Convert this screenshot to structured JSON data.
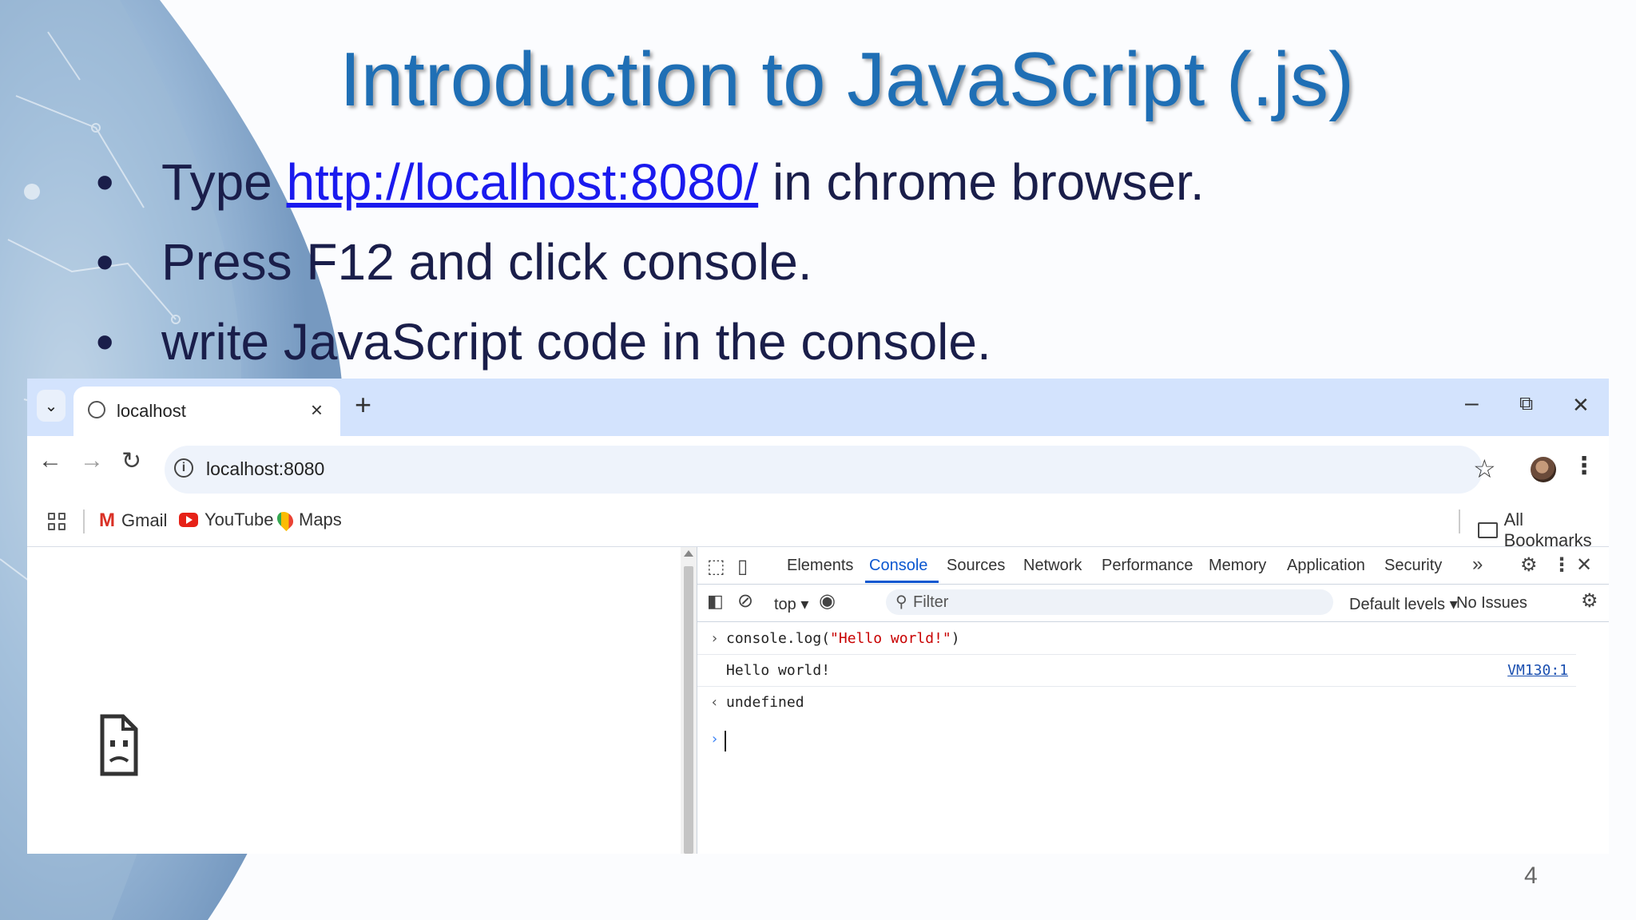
{
  "slide": {
    "title": "Introduction to JavaScript (.js)",
    "bullets": {
      "b1_pre": "Type ",
      "b1_link": "http://localhost:8080/",
      "b1_post": " in chrome browser.",
      "b2": "Press F12 and click console.",
      "b3": "write JavaScript code in the console."
    },
    "bullet_glyph": "•",
    "page_number": "4"
  },
  "browser": {
    "tab_title": "localhost",
    "tab_close": "×",
    "new_tab": "+",
    "win_minimize": "–",
    "win_restore": "⧉",
    "win_close": "✕",
    "url": "localhost:8080",
    "bookmarks": {
      "gmail": "Gmail",
      "youtube": "YouTube",
      "maps": "Maps",
      "all": "All Bookmarks"
    }
  },
  "devtools": {
    "tabs": [
      "Elements",
      "Console",
      "Sources",
      "Network",
      "Performance",
      "Memory",
      "Application",
      "Security"
    ],
    "active_tab": "Console",
    "context": "top ▾",
    "filter_placeholder": "Filter",
    "levels": "Default levels ▾",
    "issues": "No Issues",
    "console": {
      "input_prefix": "console.log(",
      "input_string": "\"Hello world!\"",
      "input_suffix": ")",
      "output": "Hello world!",
      "source_link": "VM130:1",
      "result": "undefined"
    }
  },
  "colors": {
    "title": "#1f6fb5",
    "bullet_text": "#1a1e4a",
    "link": "#1a1aee",
    "tab_bar": "#d3e3fd",
    "active_tab": "#0b57d0"
  }
}
